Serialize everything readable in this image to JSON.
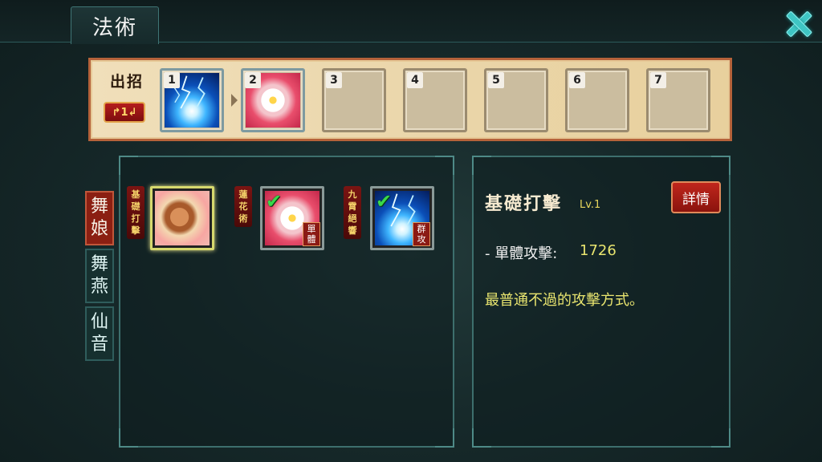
{
  "header": {
    "title": "法術"
  },
  "sequence": {
    "label": "出招",
    "badge": "↱1↲",
    "slots": [
      {
        "num": "1",
        "skill": "lightning"
      },
      {
        "num": "2",
        "skill": "flower"
      },
      {
        "num": "3",
        "skill": ""
      },
      {
        "num": "4",
        "skill": ""
      },
      {
        "num": "5",
        "skill": ""
      },
      {
        "num": "6",
        "skill": ""
      },
      {
        "num": "7",
        "skill": ""
      }
    ]
  },
  "characters": {
    "tabs": [
      {
        "label_1": "舞",
        "label_2": "娘",
        "active": true
      },
      {
        "label_1": "舞",
        "label_2": "燕",
        "active": false
      },
      {
        "label_1": "仙",
        "label_2": "音",
        "active": false
      }
    ]
  },
  "skills": [
    {
      "name": "基礎打擊",
      "art": "fist",
      "selected": true,
      "equipped": false,
      "tag": ""
    },
    {
      "name": "蓮花術",
      "art": "flower",
      "selected": false,
      "equipped": true,
      "tag": "單體"
    },
    {
      "name": "九霄絕響",
      "art": "lightning",
      "selected": false,
      "equipped": true,
      "tag": "群攻"
    }
  ],
  "detail": {
    "name": "基礎打擊",
    "level": "Lv.1",
    "button": "詳情",
    "stat_label": "- 單體攻擊:",
    "stat_value": "1726",
    "description": "最普通不過的攻擊方式。"
  },
  "colors": {
    "accent_teal": "#3fc6c4",
    "highlight_yellow": "#e9e56f",
    "button_red": "#c0261c"
  }
}
